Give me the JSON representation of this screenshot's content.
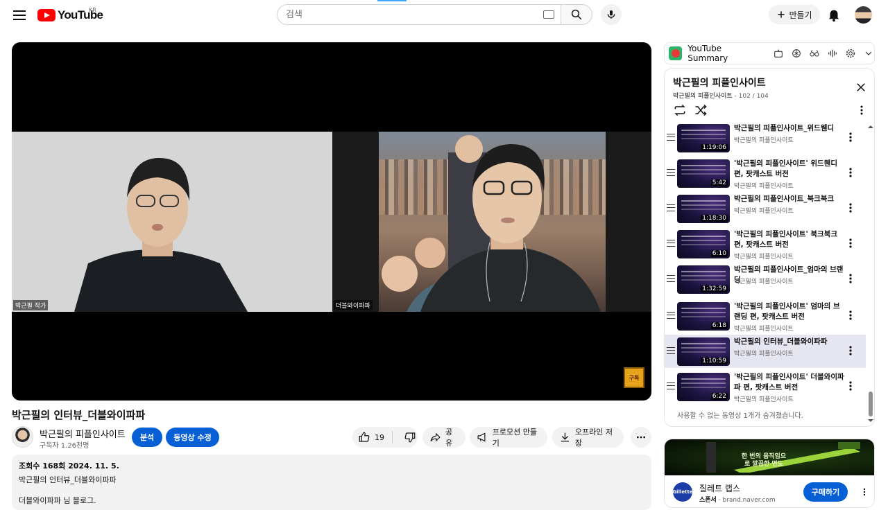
{
  "header": {
    "logo_text": "YouTube",
    "region": "KR",
    "search_placeholder": "검색",
    "create_label": "만들기"
  },
  "player": {
    "left_label": "박근필 작가",
    "right_label": "더블와이파파",
    "subscribe_badge": "구독"
  },
  "video": {
    "title": "박근필의 인터뷰_더블와이파파",
    "channel": "박근필의 피플인사이트",
    "subscribers": "구독자 1.26천명",
    "analytics_label": "분석",
    "edit_label": "동영상 수정",
    "likes": "19",
    "share_label": "공유",
    "promote_label": "프로모션 만들기",
    "download_label": "오프라인 저장"
  },
  "description": {
    "stats": "조회수 168회  2024. 11. 5.",
    "line1": "박근필의 인터뷰_더블와이파파",
    "line2": "더블와이파파 님 블로그."
  },
  "summary_bar": {
    "label": "YouTube Summary",
    "icons": [
      "robot-icon",
      "chatgpt-icon",
      "glasses-icon",
      "audio-wave-icon",
      "gear-icon",
      "chevron-down-icon"
    ]
  },
  "playlist": {
    "title": "박근필의 피플인사이트",
    "channel": "박근필의 피플인사이트",
    "position": " - 102 / 104",
    "items": [
      {
        "title": "박근필의 피플인사이트_위드웬디",
        "channel": "박근필의 피플인사이트",
        "duration": "1:19:06"
      },
      {
        "title": "'박근필의 피플인사이트' 위드웬디 편, 팟캐스트 버전",
        "channel": "박근필의 피플인사이트",
        "duration": "5:42"
      },
      {
        "title": "박근필의 피플인사이트_북크북크",
        "channel": "박근필의 피플인사이트",
        "duration": "1:18:30"
      },
      {
        "title": "'박근필의 피플인사이트' 북크북크 편, 팟캐스트 버전",
        "channel": "박근필의 피플인사이트",
        "duration": "6:10"
      },
      {
        "title": "박근필의 피플인사이트_엄마의 브랜딩",
        "channel": "박근필의 피플인사이트",
        "duration": "1:32:59"
      },
      {
        "title": "'박근필의 피플인사이트' 엄마의 브랜딩 편, 팟캐스트 버전",
        "channel": "박근필의 피플인사이트",
        "duration": "6:18"
      },
      {
        "title": "박근필의 인터뷰_더블와이파파",
        "channel": "박근필의 피플인사이트",
        "duration": "1:10:59",
        "active": true
      },
      {
        "title": "'박근필의 피플인사이트' 더블와이파파 편, 팟캐스트 버전",
        "channel": "박근필의 피플인사이트",
        "duration": "6:22"
      }
    ],
    "hidden_note": "사용할 수 없는 동영상 1개가 숨겨졌습니다."
  },
  "ad": {
    "banner_text": "한 번의 움직임으로 깔끔한 면도",
    "name": "질레트 랩스",
    "sponsor_label": "스폰서",
    "domain": "brand.naver.com",
    "buy_label": "구매하기",
    "logo_text": "Gillette"
  },
  "colors": {
    "brand_red": "#ff0000",
    "accent_blue": "#065fd4",
    "active_row": "#e6e6f1"
  }
}
